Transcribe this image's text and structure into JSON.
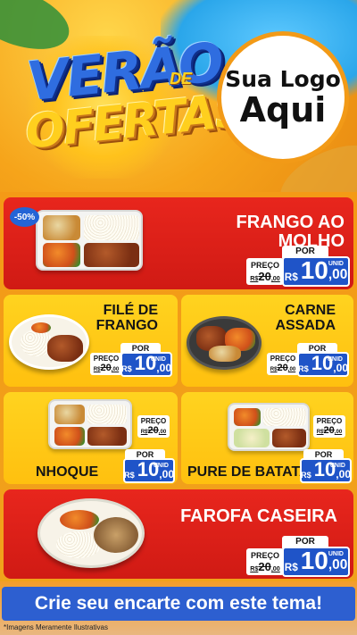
{
  "header": {
    "title_line1": "VERÃO",
    "title_de": "DE",
    "title_line2": "OFERTAS",
    "logo_line1": "Sua Logo",
    "logo_line2": "Aqui"
  },
  "colors": {
    "red_card": "#e8261d",
    "yellow_card": "#ffd31f",
    "price_blue": "#1f54c8",
    "cta_blue": "#2d5fd0"
  },
  "products": [
    {
      "name_lines": [
        "FRANGO AO MOLHO"
      ],
      "badge": "-50%",
      "preco_label": "PREÇO",
      "old_currency": "R$",
      "old_price": "20",
      "old_cents": ",00",
      "por_label": "POR",
      "currency": "R$",
      "price_int": "10",
      "price_cents": ",00",
      "unit": "UNID"
    },
    {
      "name_lines": [
        "FILÉ DE",
        "FRANGO"
      ],
      "preco_label": "PREÇO",
      "old_currency": "R$",
      "old_price": "20",
      "old_cents": ",00",
      "por_label": "POR",
      "currency": "R$",
      "price_int": "10",
      "price_cents": ",00",
      "unit": "UNID"
    },
    {
      "name_lines": [
        "CARNE",
        "ASSADA"
      ],
      "preco_label": "PREÇO",
      "old_currency": "R$",
      "old_price": "20",
      "old_cents": ",00",
      "por_label": "POR",
      "currency": "R$",
      "price_int": "10",
      "price_cents": ",00",
      "unit": "UNID"
    },
    {
      "name_lines": [
        "NHOQUE"
      ],
      "preco_label": "PREÇO",
      "old_currency": "R$",
      "old_price": "20",
      "old_cents": ",00",
      "por_label": "POR",
      "currency": "R$",
      "price_int": "10",
      "price_cents": ",00",
      "unit": "UNID"
    },
    {
      "name_lines": [
        "PURE DE BATATA"
      ],
      "preco_label": "PREÇO",
      "old_currency": "R$",
      "old_price": "20",
      "old_cents": ",00",
      "por_label": "POR",
      "currency": "R$",
      "price_int": "10",
      "price_cents": ",00",
      "unit": "UNID"
    },
    {
      "name_lines": [
        "FAROFA CASEIRA"
      ],
      "preco_label": "PREÇO",
      "old_currency": "R$",
      "old_price": "20",
      "old_cents": ",00",
      "por_label": "POR",
      "currency": "R$",
      "price_int": "10",
      "price_cents": ",00",
      "unit": "UNID"
    }
  ],
  "cta": {
    "label": "Crie seu encarte com este tema!"
  },
  "footnote": "*Imagens Meramente Ilustrativas"
}
